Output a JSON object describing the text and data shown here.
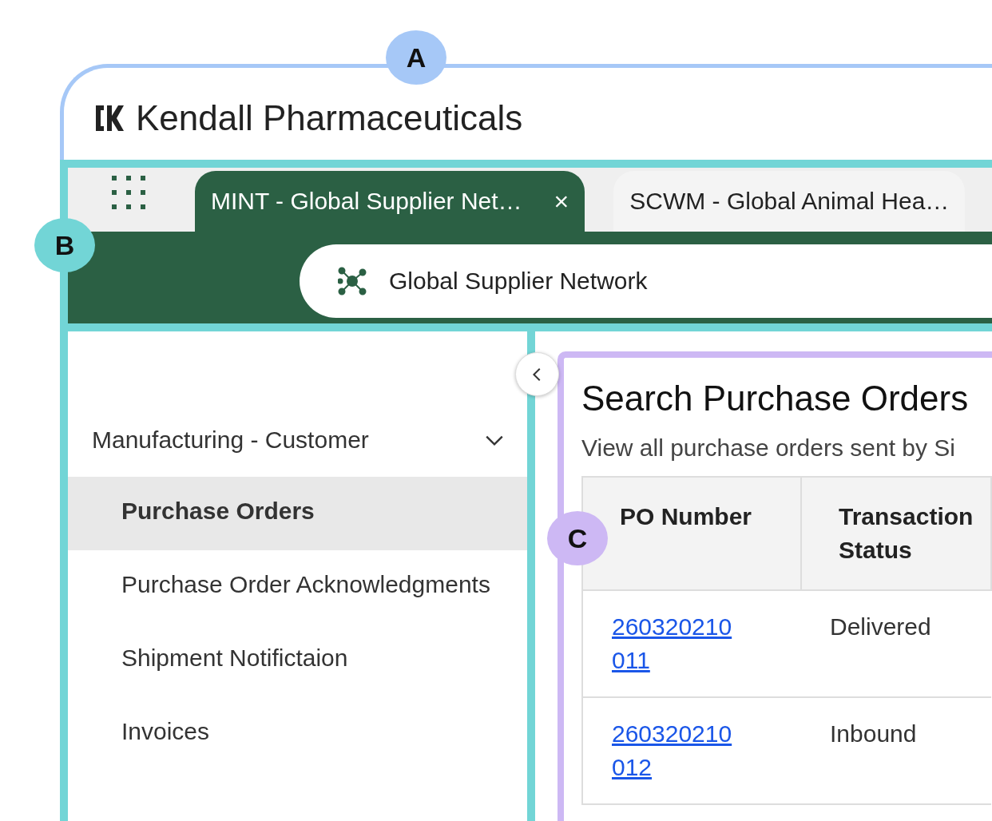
{
  "callouts": [
    {
      "label": "A",
      "color": "#a6c8f7"
    },
    {
      "label": "B",
      "color": "#72d5d6"
    },
    {
      "label": "C",
      "color": "#cdb8f4"
    }
  ],
  "header": {
    "brand": "Kendall Pharmaceuticals"
  },
  "tabs": [
    {
      "label": "MINT - Global Supplier Net…",
      "selected": true,
      "close": "×"
    },
    {
      "label": "SCWM - Global Animal Hea…",
      "selected": false
    }
  ],
  "app_bar": {
    "title": "Global Supplier Network"
  },
  "sidebar": {
    "group": {
      "label": "Manufacturing - Customer",
      "expanded": true
    },
    "items": [
      {
        "label": "Purchase Orders",
        "selected": true
      },
      {
        "label": "Purchase Order Acknowledgments",
        "selected": false
      },
      {
        "label": "Shipment Notifictaion",
        "selected": false
      },
      {
        "label": "Invoices",
        "selected": false
      }
    ]
  },
  "main": {
    "title": "Search Purchase Orders",
    "subtitle": "View all purchase orders sent by Si",
    "table": {
      "columns": [
        "PO Number",
        "Transaction Status"
      ],
      "rows": [
        {
          "po_number": "260320210011",
          "status": "Delivered"
        },
        {
          "po_number": "260320210012",
          "status": "Inbound"
        }
      ]
    }
  }
}
